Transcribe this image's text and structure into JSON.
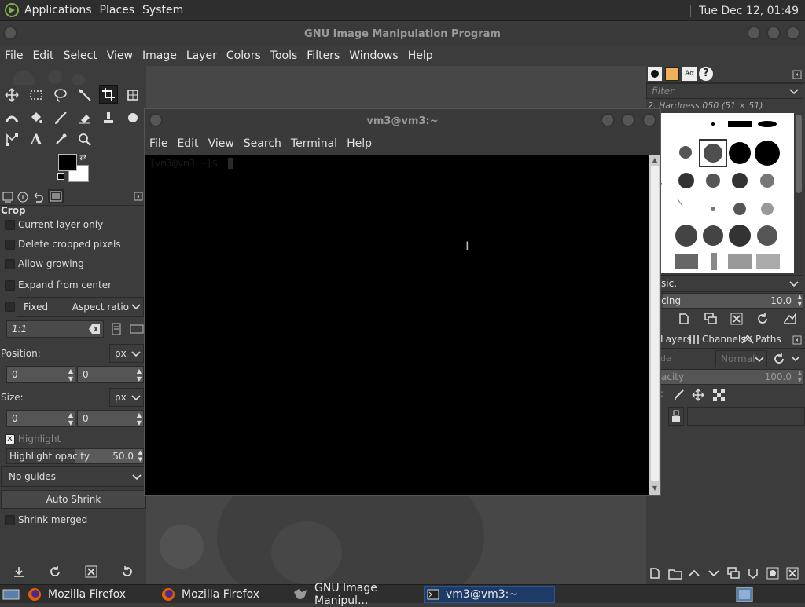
{
  "top_panel": {
    "menus": [
      "Applications",
      "Places",
      "System"
    ],
    "clock": "Tue Dec 12, 01:49"
  },
  "gimp": {
    "title": "GNU Image Manipulation Program",
    "menus": [
      "File",
      "Edit",
      "Select",
      "View",
      "Image",
      "Layer",
      "Colors",
      "Tools",
      "Filters",
      "Windows",
      "Help"
    ],
    "tool_options": {
      "title": "Crop",
      "current_layer_only": "Current layer only",
      "delete_cropped": "Delete cropped pixels",
      "allow_growing": "Allow growing",
      "expand_center": "Expand from center",
      "fixed": "Fixed",
      "aspect_ratio": "Aspect ratio",
      "ratio_value": "1:1",
      "position_label": "Position:",
      "position_unit": "px",
      "position_x": "0",
      "position_y": "0",
      "size_label": "Size:",
      "size_unit": "px",
      "size_w": "0",
      "size_h": "0",
      "highlight": "Highlight",
      "highlight_opacity_label": "Highlight opacity",
      "highlight_opacity_value": "50.0",
      "highlight_opacity_fraction": 0.5,
      "guides": "No guides",
      "auto_shrink": "Auto Shrink",
      "shrink_merged": "Shrink merged"
    },
    "brushes": {
      "filter_placeholder": "filter",
      "brush_name": "2. Hardness 050 (51 × 51)",
      "tag": "sic,",
      "spacing_label": "cing",
      "spacing_value": "10.0"
    },
    "layers": {
      "tabs": [
        "Layers",
        "Channels",
        "Paths"
      ],
      "mode_label": "de",
      "mode_value": "Normal",
      "opacity_label": "acity",
      "opacity_value": "100.0",
      "lock_label": ":"
    }
  },
  "terminal": {
    "title": "vm3@vm3:~",
    "menus": [
      "File",
      "Edit",
      "View",
      "Search",
      "Terminal",
      "Help"
    ],
    "prompt": "[vm3@vm3 ~]$"
  },
  "taskbar": {
    "items": [
      "Mozilla Firefox",
      "Mozilla Firefox",
      "GNU Image Manipul...",
      "vm3@vm3:~"
    ]
  },
  "colors": {
    "panel": "#2e2e2e",
    "gimp_bg": "#3c3c3c",
    "canvas": "#474747",
    "accent_blue": "#1e3a66",
    "terminal_bg": "#000000"
  }
}
